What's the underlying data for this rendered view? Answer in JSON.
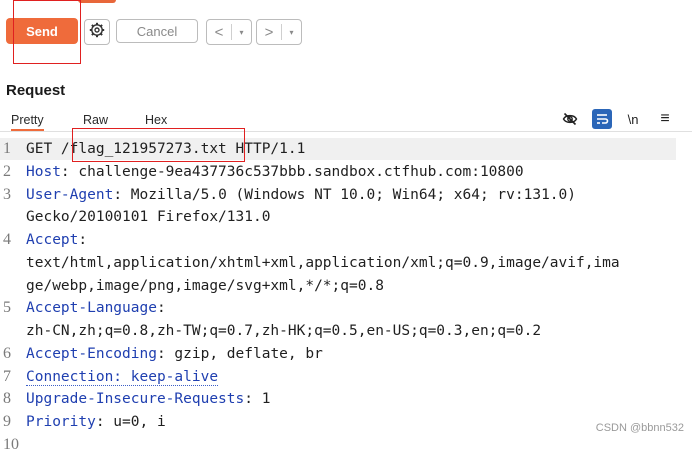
{
  "toolbar": {
    "send_label": "Send",
    "cancel_label": "Cancel",
    "prev_label": "<",
    "next_label": ">",
    "dropdown_caret": "▾"
  },
  "request": {
    "title": "Request",
    "tabs": [
      "Pretty",
      "Raw",
      "Hex"
    ],
    "active_tab": "Pretty",
    "icons": [
      "eye-off-icon",
      "wrap-text-icon",
      "newline-icon",
      "menu-icon"
    ],
    "newline_label": "\\n",
    "menu_label": "≡"
  },
  "lines": [
    {
      "num": "1",
      "parts": [
        {
          "t": "GET /flag_121957273.txt HTTP/1.1",
          "c": "plain"
        }
      ]
    },
    {
      "num": "2",
      "parts": [
        {
          "t": "Host",
          "c": "name"
        },
        {
          "t": ": challenge-9ea437736c537bbb.sandbox.ctfhub.com:10800",
          "c": "plain"
        }
      ]
    },
    {
      "num": "3",
      "parts": [
        {
          "t": "User-Agent",
          "c": "name"
        },
        {
          "t": ": Mozilla/5.0 (Windows NT 10.0; Win64; x64; rv:131.0)",
          "c": "plain"
        }
      ]
    },
    {
      "num": "",
      "parts": [
        {
          "t": "Gecko/20100101 Firefox/131.0",
          "c": "plain"
        }
      ]
    },
    {
      "num": "4",
      "parts": [
        {
          "t": "Accept",
          "c": "name"
        },
        {
          "t": ":",
          "c": "plain"
        }
      ]
    },
    {
      "num": "",
      "parts": [
        {
          "t": "text/html,application/xhtml+xml,application/xml;q=0.9,image/avif,ima",
          "c": "plain"
        }
      ]
    },
    {
      "num": "",
      "parts": [
        {
          "t": "ge/webp,image/png,image/svg+xml,*/*;q=0.8",
          "c": "plain"
        }
      ]
    },
    {
      "num": "5",
      "parts": [
        {
          "t": "Accept-Language",
          "c": "name"
        },
        {
          "t": ":",
          "c": "plain"
        }
      ]
    },
    {
      "num": "",
      "parts": [
        {
          "t": "zh-CN,zh;q=0.8,zh-TW;q=0.7,zh-HK;q=0.5,en-US;q=0.3,en;q=0.2",
          "c": "plain"
        }
      ]
    },
    {
      "num": "6",
      "parts": [
        {
          "t": "Accept-Encoding",
          "c": "name"
        },
        {
          "t": ": gzip, deflate, br",
          "c": "plain"
        }
      ]
    },
    {
      "num": "7",
      "parts": [
        {
          "t": "Connection: keep-alive",
          "c": "dotted"
        }
      ]
    },
    {
      "num": "8",
      "parts": [
        {
          "t": "Upgrade-Insecure-Requests",
          "c": "name"
        },
        {
          "t": ": 1",
          "c": "plain"
        }
      ]
    },
    {
      "num": "9",
      "parts": [
        {
          "t": "Priority",
          "c": "name"
        },
        {
          "t": ": u=0, i",
          "c": "plain"
        }
      ]
    },
    {
      "num": "10",
      "parts": []
    }
  ],
  "watermark": "CSDN @bbnn532",
  "colors": {
    "accent": "#ef6b3b",
    "header_name": "#1f3fb0",
    "annotation": "#e02020"
  }
}
